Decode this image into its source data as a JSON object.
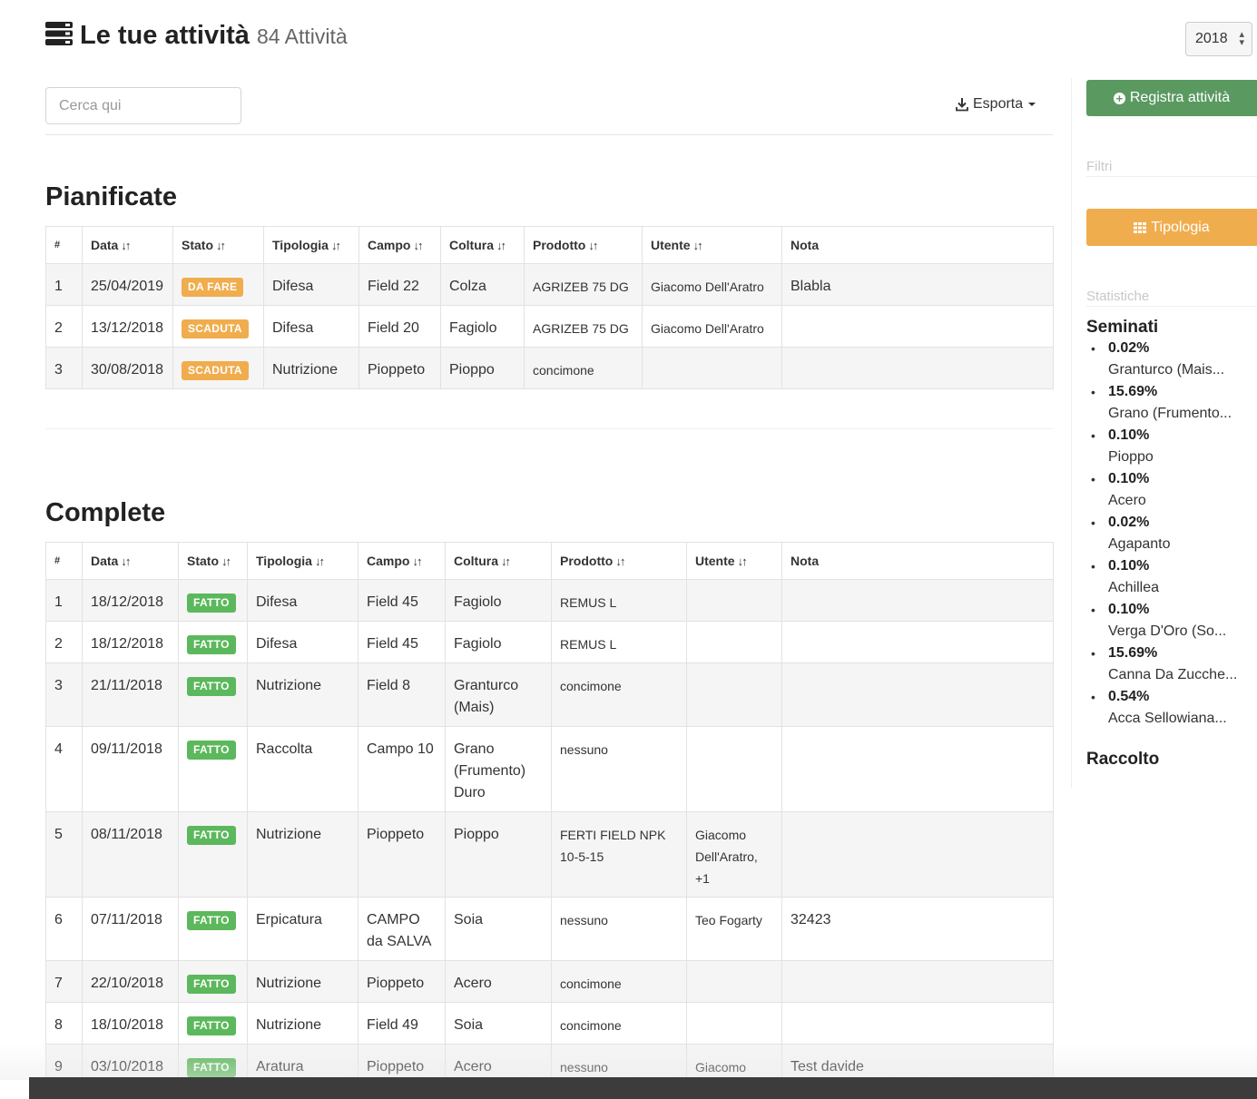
{
  "header": {
    "title": "Le tue attività",
    "count": "84 Attività",
    "icon": "list-icon"
  },
  "year_select": {
    "value": "2018"
  },
  "search": {
    "placeholder": "Cerca qui"
  },
  "export": {
    "label": "Esporta"
  },
  "sidebar": {
    "register_label": "Registra attività",
    "filters_label": "Filtri",
    "tipologia_label": "Tipologia",
    "stats_label": "Statistiche",
    "seminati_title": "Seminati",
    "seminati": [
      {
        "pct": "0.02%",
        "crop": "Granturco (Mais..."
      },
      {
        "pct": "15.69%",
        "crop": "Grano (Frumento..."
      },
      {
        "pct": "0.10%",
        "crop": "Pioppo"
      },
      {
        "pct": "0.10%",
        "crop": "Acero"
      },
      {
        "pct": "0.02%",
        "crop": "Agapanto"
      },
      {
        "pct": "0.10%",
        "crop": "Achillea"
      },
      {
        "pct": "0.10%",
        "crop": "Verga D'Oro (So..."
      },
      {
        "pct": "15.69%",
        "crop": "Canna Da Zucche..."
      },
      {
        "pct": "0.54%",
        "crop": "Acca Sellowiana..."
      }
    ],
    "raccolto_title": "Raccolto"
  },
  "columns": {
    "idx": "#",
    "data": "Data",
    "stato": "Stato",
    "tipologia": "Tipologia",
    "campo": "Campo",
    "coltura": "Coltura",
    "prodotto": "Prodotto",
    "utente": "Utente",
    "nota": "Nota"
  },
  "pianificate": {
    "title": "Pianificate",
    "rows": [
      {
        "n": "1",
        "data": "25/04/2019",
        "stato": "DA FARE",
        "tipologia": "Difesa",
        "campo": "Field 22",
        "coltura": "Colza",
        "prodotto": "AGRIZEB 75 DG",
        "utente": "Giacomo Dell'Aratro",
        "nota": "Blabla"
      },
      {
        "n": "2",
        "data": "13/12/2018",
        "stato": "SCADUTA",
        "tipologia": "Difesa",
        "campo": "Field 20",
        "coltura": "Fagiolo",
        "prodotto": "AGRIZEB 75 DG",
        "utente": "Giacomo Dell'Aratro",
        "nota": ""
      },
      {
        "n": "3",
        "data": "30/08/2018",
        "stato": "SCADUTA",
        "tipologia": "Nutrizione",
        "campo": "Pioppeto",
        "coltura": "Pioppo",
        "prodotto": "concimone",
        "utente": "",
        "nota": ""
      }
    ]
  },
  "complete": {
    "title": "Complete",
    "rows": [
      {
        "n": "1",
        "data": "18/12/2018",
        "stato": "FATTO",
        "tipologia": "Difesa",
        "campo": "Field 45",
        "coltura": "Fagiolo",
        "prodotto": "REMUS L",
        "utente": "",
        "nota": ""
      },
      {
        "n": "2",
        "data": "18/12/2018",
        "stato": "FATTO",
        "tipologia": "Difesa",
        "campo": "Field 45",
        "coltura": "Fagiolo",
        "prodotto": "REMUS L",
        "utente": "",
        "nota": ""
      },
      {
        "n": "3",
        "data": "21/11/2018",
        "stato": "FATTO",
        "tipologia": "Nutrizione",
        "campo": "Field 8",
        "coltura": "Granturco (Mais)",
        "prodotto": "concimone",
        "utente": "",
        "nota": ""
      },
      {
        "n": "4",
        "data": "09/11/2018",
        "stato": "FATTO",
        "tipologia": "Raccolta",
        "campo": "Campo 10",
        "coltura": "Grano (Frumento) Duro",
        "prodotto": "nessuno",
        "utente": "",
        "nota": ""
      },
      {
        "n": "5",
        "data": "08/11/2018",
        "stato": "FATTO",
        "tipologia": "Nutrizione",
        "campo": "Pioppeto",
        "coltura": "Pioppo",
        "prodotto": "FERTI FIELD NPK 10-5-15",
        "utente": "Giacomo Dell'Aratro, +1",
        "nota": ""
      },
      {
        "n": "6",
        "data": "07/11/2018",
        "stato": "FATTO",
        "tipologia": "Erpicatura",
        "campo": "CAMPO da SALVA",
        "coltura": "Soia",
        "prodotto": "nessuno",
        "utente": "Teo Fogarty",
        "nota": "32423"
      },
      {
        "n": "7",
        "data": "22/10/2018",
        "stato": "FATTO",
        "tipologia": "Nutrizione",
        "campo": "Pioppeto",
        "coltura": "Acero",
        "prodotto": "concimone",
        "utente": "",
        "nota": ""
      },
      {
        "n": "8",
        "data": "18/10/2018",
        "stato": "FATTO",
        "tipologia": "Nutrizione",
        "campo": "Field 49",
        "coltura": "Soia",
        "prodotto": "concimone",
        "utente": "",
        "nota": ""
      },
      {
        "n": "9",
        "data": "03/10/2018",
        "stato": "FATTO",
        "tipologia": "Aratura",
        "campo": "Pioppeto",
        "coltura": "Acero",
        "prodotto": "nessuno",
        "utente": "Giacomo Dell'Aratro,",
        "nota": "Test davide"
      }
    ]
  },
  "colors": {
    "green": "#5cb85c",
    "orange": "#f0ad4e",
    "register": "#5a9a60"
  }
}
